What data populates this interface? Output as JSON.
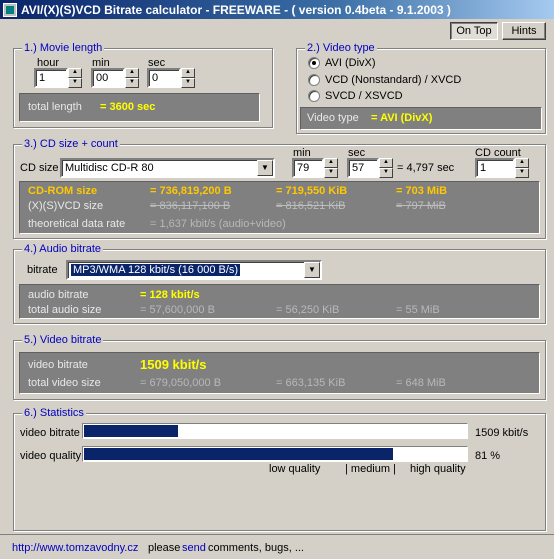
{
  "window": {
    "title": "AVI/(X)(S)VCD Bitrate calculator  - FREEWARE -  ( version 0.4beta - 9.1.2003 )",
    "icon": "calculator-app-icon"
  },
  "toolbar": {
    "on_top_label": "On Top",
    "hints_label": "Hints"
  },
  "movie_length": {
    "legend": "1.) Movie length",
    "hour_label": "hour",
    "hour_value": "1",
    "min_label": "min",
    "min_value": "00",
    "sec_label": "sec",
    "sec_value": "0",
    "total_label": "total length",
    "total_value": "= 3600 sec"
  },
  "video_type": {
    "legend": "2.) Video type",
    "options": [
      "AVI (DivX)",
      "VCD (Nonstandard) / XVCD",
      "SVCD / XSVCD"
    ],
    "selected_index": 0,
    "result_label": "Video type",
    "result_value": "= AVI (DivX)"
  },
  "cd_size": {
    "legend": "3.) CD size + count",
    "cd_size_label": "CD size",
    "cd_size_value": "Multidisc CD-R 80",
    "min_label": "min",
    "min_value": "79",
    "sec_label": "sec",
    "sec_value": "57",
    "duration_text": "= 4,797 sec",
    "cd_count_label": "CD count",
    "cd_count_value": "1",
    "cdrom_label": "CD-ROM size",
    "cdrom_bytes": "= 736,819,200 B",
    "cdrom_kib": "= 719,550 KiB",
    "cdrom_mib": "= 703 MiB",
    "vcd_label": "(X)(S)VCD size",
    "vcd_bytes": "= 836,117,100 B",
    "vcd_kib": "= 816,521 KiB",
    "vcd_mib": "= 797 MiB",
    "rate_label": "theoretical data rate",
    "rate_value": "= 1,637 kbit/s (audio+video)"
  },
  "audio": {
    "legend": "4.) Audio bitrate",
    "bitrate_label": "bitrate",
    "bitrate_value": "MP3/WMA 128 kbit/s (16 000 B/s)",
    "audio_bitrate_label": "audio bitrate",
    "audio_bitrate_value": "= 128 kbit/s",
    "total_label": "total audio size",
    "total_bytes": "= 57,600,000 B",
    "total_kib": "= 56,250 KiB",
    "total_mib": "= 55 MiB"
  },
  "video": {
    "legend": "5.) Video bitrate",
    "bitrate_label": "video bitrate",
    "bitrate_value": "1509 kbit/s",
    "total_label": "total video size",
    "total_bytes": "= 679,050,000 B",
    "total_kib": "= 663,135 KiB",
    "total_mib": "= 648 MiB"
  },
  "statistics": {
    "legend": "6.) Statistics",
    "bitrate_label": "video bitrate",
    "bitrate_value": "1509 kbit/s",
    "bitrate_fill": 0.25,
    "quality_label": "video quality",
    "quality_value": "81 %",
    "quality_fill": 0.81,
    "scale_low": "low quality",
    "scale_medium": "| medium |",
    "scale_high": "high quality"
  },
  "status": {
    "url": "http://www.tomzavodny.cz",
    "text_before": "please",
    "send_link": "send",
    "text_after": "comments, bugs, ..."
  },
  "colors": {
    "panel_bg": "#808080",
    "highlight": "#ffff00",
    "cdrom": "#ffc800",
    "accent": "#0a246a",
    "legend": "#0000c0"
  }
}
